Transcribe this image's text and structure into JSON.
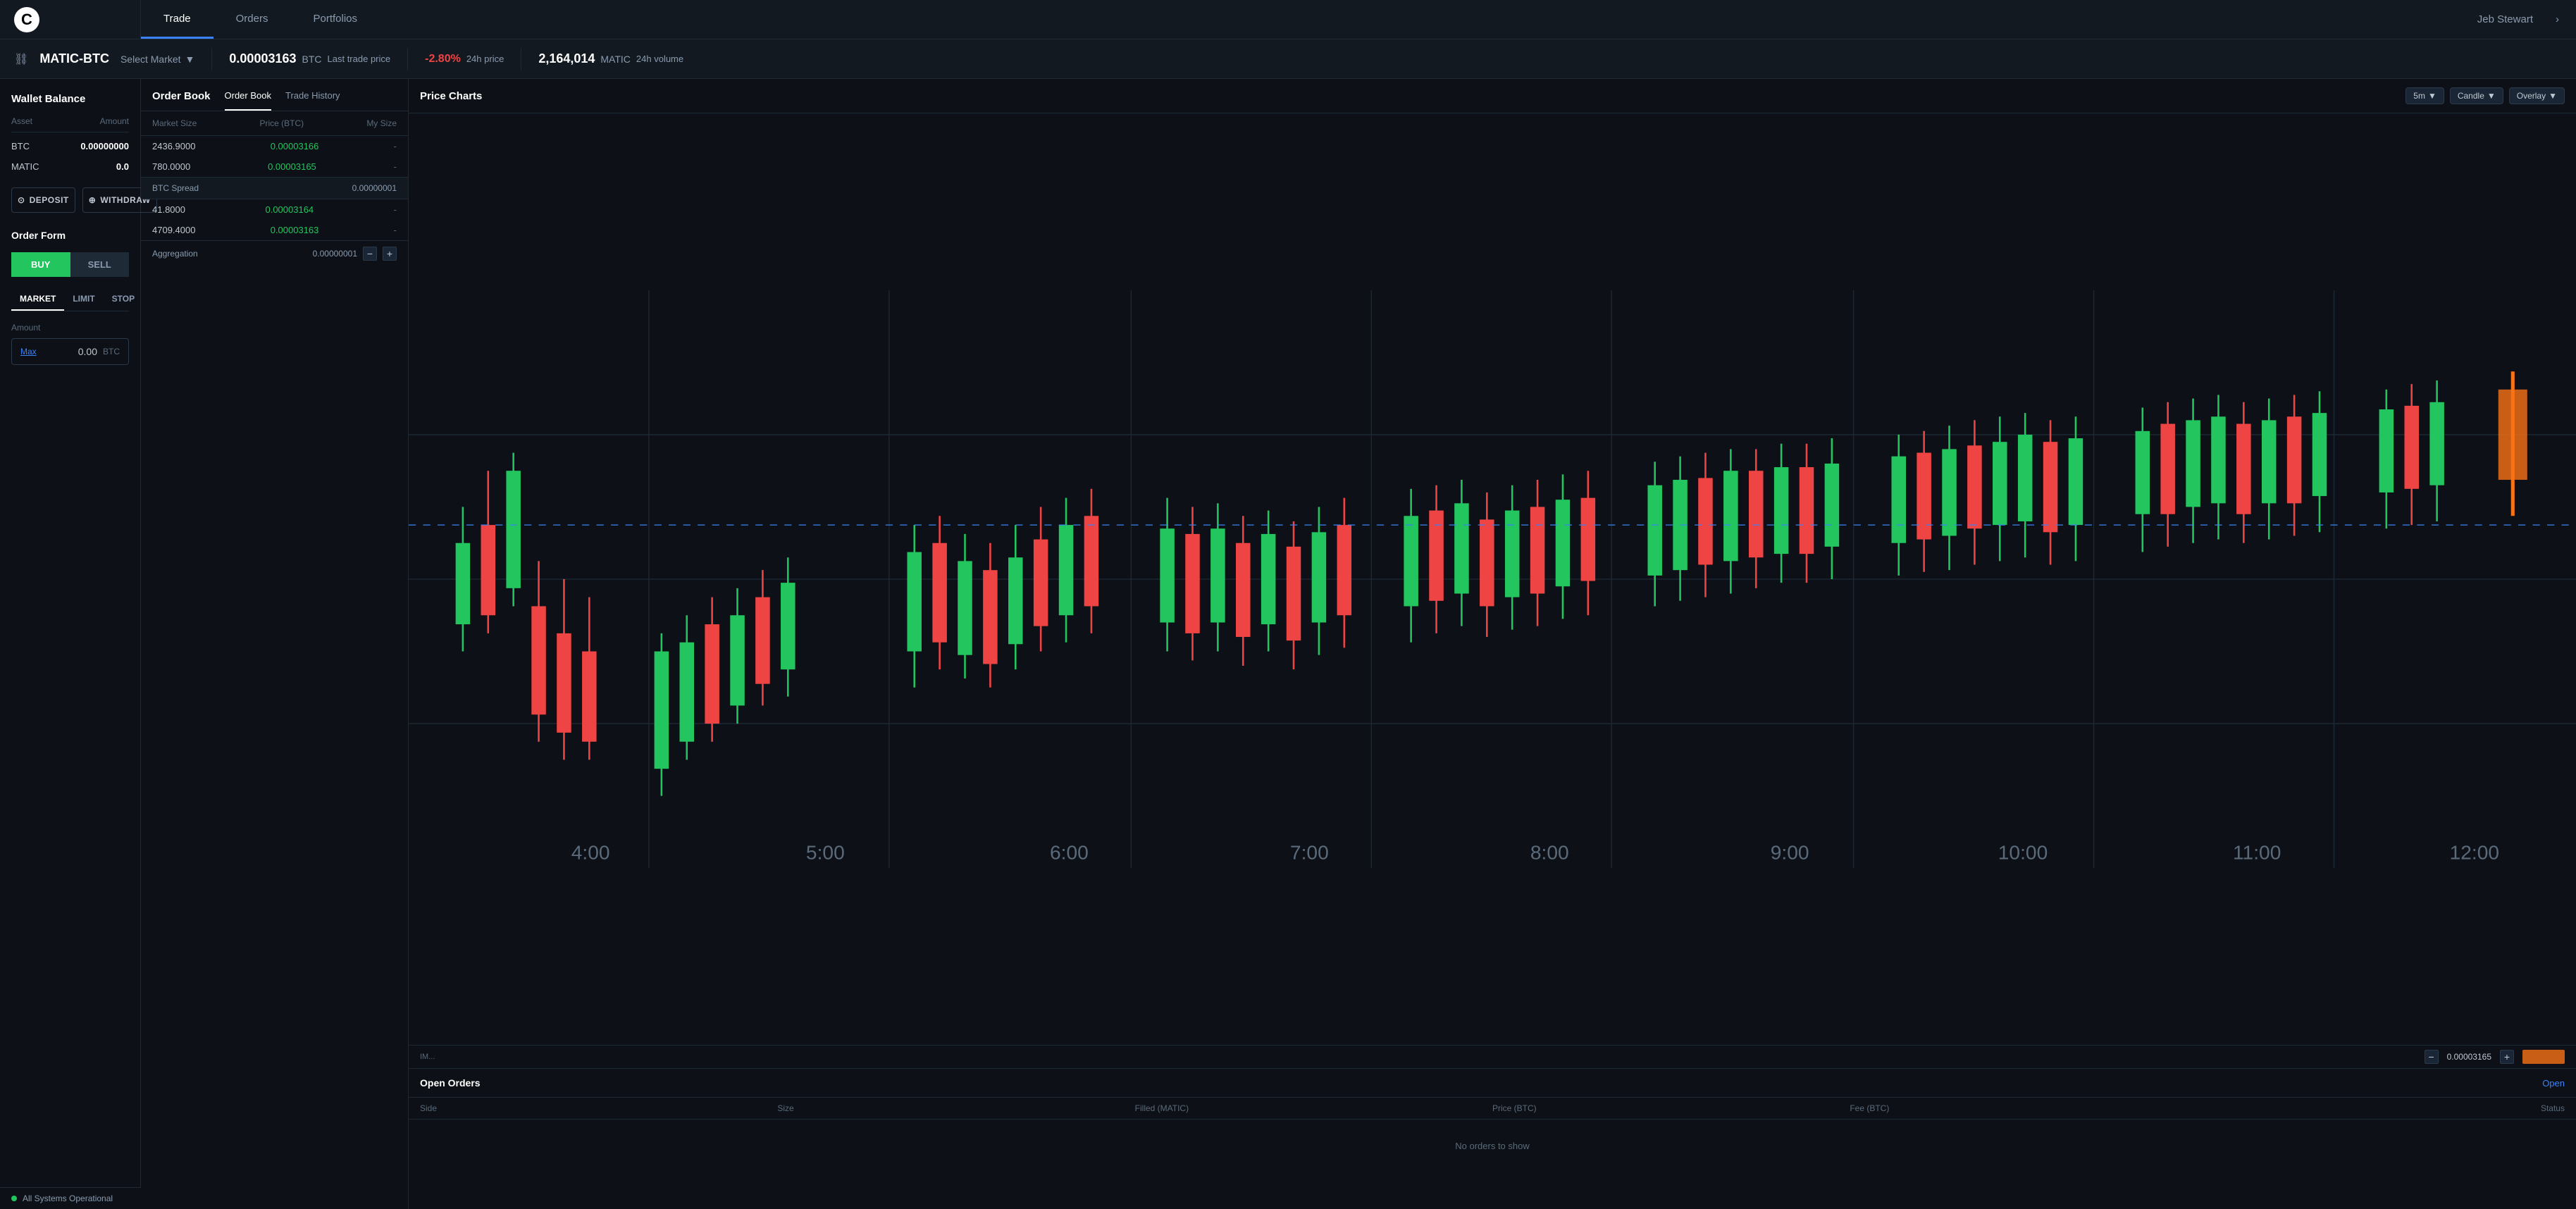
{
  "app": {
    "logo": "C",
    "status": "All Systems Operational"
  },
  "nav": {
    "tabs": [
      {
        "id": "trade",
        "label": "Trade",
        "active": true
      },
      {
        "id": "orders",
        "label": "Orders",
        "active": false
      },
      {
        "id": "portfolios",
        "label": "Portfolios",
        "active": false
      }
    ],
    "user": "Jeb Stewart"
  },
  "market_bar": {
    "link_icon": "⛓",
    "pair": "MATIC-BTC",
    "select_market": "Select Market",
    "last_trade_price_value": "0.00003163",
    "last_trade_price_currency": "BTC",
    "last_trade_price_label": "Last trade price",
    "price_change": "-2.80%",
    "price_change_label": "24h price",
    "volume_value": "2,164,014",
    "volume_currency": "MATIC",
    "volume_label": "24h volume"
  },
  "wallet": {
    "title": "Wallet Balance",
    "asset_col": "Asset",
    "amount_col": "Amount",
    "assets": [
      {
        "name": "BTC",
        "amount": "0.00000000"
      },
      {
        "name": "MATIC",
        "amount": "0.0"
      }
    ],
    "deposit_btn": "DEPOSIT",
    "withdraw_btn": "WITHDRAW"
  },
  "order_form": {
    "title": "Order Form",
    "buy_label": "BUY",
    "sell_label": "SELL",
    "types": [
      {
        "id": "market",
        "label": "MARKET",
        "active": true
      },
      {
        "id": "limit",
        "label": "LIMIT",
        "active": false
      },
      {
        "id": "stop",
        "label": "STOP",
        "active": false
      }
    ],
    "amount_label": "Amount",
    "amount_max": "Max",
    "amount_value": "0.00",
    "amount_unit": "BTC"
  },
  "order_book": {
    "title": "Order Book",
    "tabs": [
      {
        "id": "orderbook",
        "label": "Order Book",
        "active": true
      },
      {
        "id": "tradehistory",
        "label": "Trade History",
        "active": false
      }
    ],
    "col_market_size": "Market Size",
    "col_price": "Price (BTC)",
    "col_my_size": "My Size",
    "rows_sell": [
      {
        "size": "2436.9000",
        "price": "0.00003166",
        "my_size": "-"
      },
      {
        "size": "780.0000",
        "price": "0.00003165",
        "my_size": "-"
      }
    ],
    "spread_label": "BTC Spread",
    "spread_value": "0.00000001",
    "rows_buy": [
      {
        "size": "41.8000",
        "price": "0.00003164",
        "my_size": "-"
      },
      {
        "size": "4709.4000",
        "price": "0.00003163",
        "my_size": "-"
      }
    ],
    "aggregation_label": "Aggregation",
    "aggregation_value": "0.00000001"
  },
  "price_chart": {
    "title": "Price Charts",
    "timeframe": "5m",
    "chart_type": "Candle",
    "overlay": "Overlay",
    "time_labels": [
      "4:00",
      "5:00",
      "6:00",
      "7:00",
      "8:00",
      "9:00",
      "10:00",
      "11:00",
      "12:00"
    ],
    "overlay_bottom_price": "0.00003165",
    "overlay_label": "IM..."
  },
  "open_orders": {
    "title": "Open Orders",
    "open_link": "Open",
    "cols": [
      {
        "label": "Side"
      },
      {
        "label": "Size"
      },
      {
        "label": "Filled (MATIC)"
      },
      {
        "label": "Price (BTC)"
      },
      {
        "label": "Fee (BTC)"
      },
      {
        "label": "Status"
      }
    ],
    "no_orders_text": "No orders to show"
  }
}
